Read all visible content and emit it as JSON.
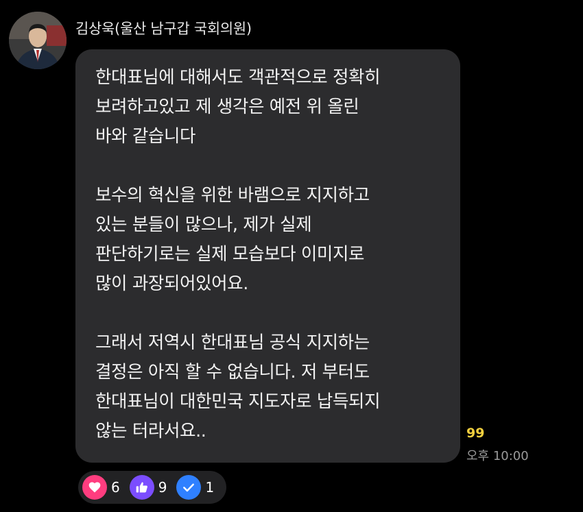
{
  "message": {
    "sender": "김상욱(울산 남구갑 국회의원)",
    "paragraphs": [
      [
        "한대표님에 대해서도 객관적으로 정확히",
        "보려하고있고 제 생각은 예전 위 올린",
        "바와 같습니다"
      ],
      [
        "보수의 혁신을 위한 바램으로 지지하고",
        "있는 분들이 많으나, 제가 실제",
        "판단하기로는 실제 모습보다 이미지로",
        "많이 과장되어있어요."
      ],
      [
        "그래서 저역시 한대표님 공식 지지하는",
        "결정은 아직 할 수 없습니다. 저 부터도",
        "한대표님이 대한민국 지도자로 납득되지",
        "않는 터라서요.."
      ]
    ],
    "unread_count": "99",
    "time": "오후 10:00"
  },
  "reactions": [
    {
      "icon": "heart-icon",
      "count": "6",
      "color": "#ff3d7f"
    },
    {
      "icon": "thumbs-up-icon",
      "count": "9",
      "color": "#7b4dff"
    },
    {
      "icon": "check-icon",
      "count": "1",
      "color": "#2f80ff"
    }
  ],
  "colors": {
    "background": "#000000",
    "bubble": "#2c2c2e",
    "unread": "#f4d03f",
    "timestamp": "#9a9a9a"
  }
}
